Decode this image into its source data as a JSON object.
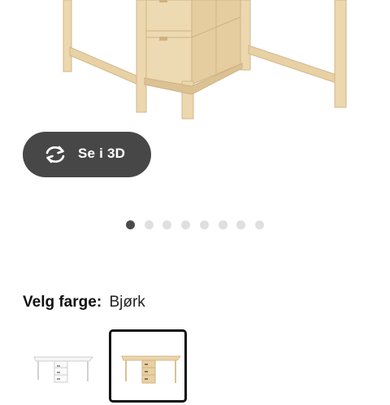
{
  "product": {
    "image_icon": "drop-leaf-table-with-drawers-birch"
  },
  "view_3d": {
    "label": "Se i 3D",
    "icon": "rotate-arrows-icon",
    "color": "#474747"
  },
  "carousel": {
    "total": 8,
    "active_index": 0
  },
  "color_picker": {
    "prefix": "Velg farge:",
    "selected_value": "Bjørk",
    "options": [
      {
        "icon": "white-table-thumbnail",
        "selected": false
      },
      {
        "icon": "birch-table-thumbnail",
        "selected": true
      }
    ]
  },
  "colors": {
    "birch": "#e9d3a8",
    "birch_dark": "#d6b988",
    "white": "#f4f4f4"
  }
}
